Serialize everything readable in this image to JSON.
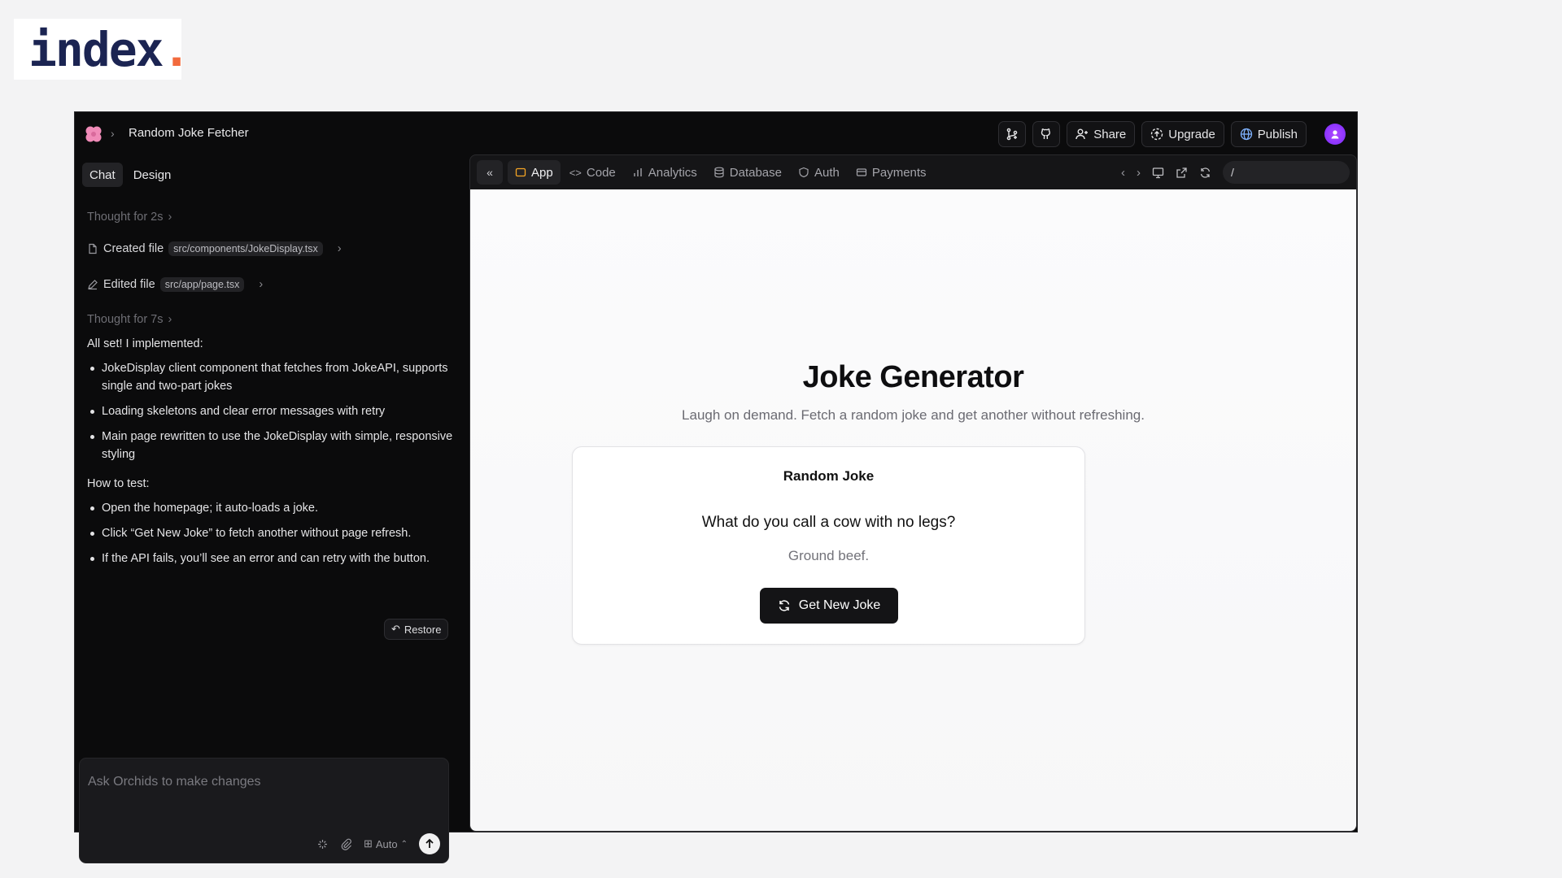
{
  "logo": {
    "text": "index",
    "dot": "."
  },
  "header": {
    "project_title": "Random Joke Fetcher",
    "share_label": "Share",
    "upgrade_label": "Upgrade",
    "publish_label": "Publish"
  },
  "left_tabs": {
    "chat": "Chat",
    "design": "Design"
  },
  "log": {
    "thought1": "Thought for 2s",
    "created_label": "Created file",
    "created_path": "src/components/JokeDisplay.tsx",
    "edited_label": "Edited file",
    "edited_path": "src/app/page.tsx",
    "thought2": "Thought for 7s",
    "summary_intro": "All set! I implemented:",
    "implemented": [
      "JokeDisplay client component that fetches from JokeAPI, supports single and two-part jokes",
      "Loading skeletons and clear error messages with retry",
      "Main page rewritten to use the JokeDisplay with simple, responsive styling"
    ],
    "test_intro": "How to test:",
    "tests": [
      "Open the homepage; it auto-loads a joke.",
      "Click “Get New Joke” to fetch another without page refresh.",
      "If the API fails, you’ll see an error and can retry with the button."
    ],
    "restore_label": "Restore"
  },
  "composer": {
    "placeholder": "Ask Orchids to make changes",
    "mode": "Auto"
  },
  "preview_tabs": {
    "app": "App",
    "code": "Code",
    "analytics": "Analytics",
    "database": "Database",
    "auth": "Auth",
    "payments": "Payments"
  },
  "url": "/",
  "preview": {
    "title": "Joke Generator",
    "subtitle": "Laugh on demand. Fetch a random joke and get another without refreshing.",
    "card_title": "Random Joke",
    "question": "What do you call a cow with no legs?",
    "answer": "Ground beef.",
    "button": "Get New Joke"
  },
  "colors": {
    "accent_app_tab": "#f5a524",
    "logo_dot": "#f26a3d",
    "logo_text": "#1b2452",
    "avatar": "#9b3cff"
  }
}
